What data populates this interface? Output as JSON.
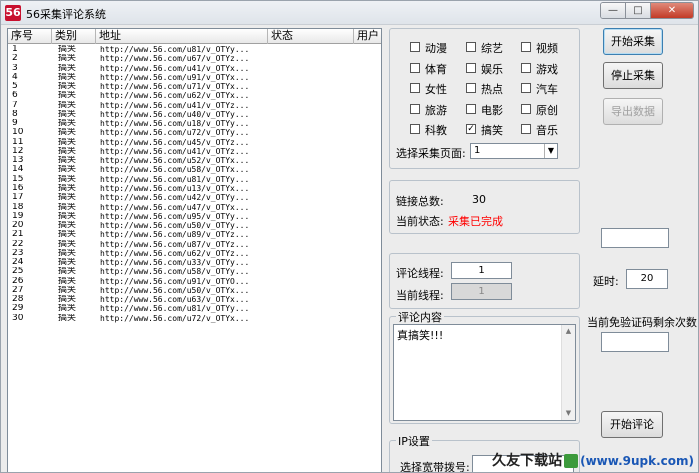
{
  "window": {
    "title": "56采集评论系统",
    "controls": {
      "minimize": "—",
      "maximize": "□",
      "close": "✕"
    }
  },
  "list": {
    "columns": [
      "序号",
      "类别",
      "地址",
      "状态",
      "用户"
    ],
    "rows": [
      {
        "num": "1",
        "cat": "搞笑",
        "url": "http://www.56.com/u81/v_OTYy..."
      },
      {
        "num": "2",
        "cat": "搞笑",
        "url": "http://www.56.com/u67/v_OTYz..."
      },
      {
        "num": "3",
        "cat": "搞笑",
        "url": "http://www.56.com/u41/v_OTYx..."
      },
      {
        "num": "4",
        "cat": "搞笑",
        "url": "http://www.56.com/u91/v_OTYx..."
      },
      {
        "num": "5",
        "cat": "搞笑",
        "url": "http://www.56.com/u71/v_OTYx..."
      },
      {
        "num": "6",
        "cat": "搞笑",
        "url": "http://www.56.com/u62/v_OTYx..."
      },
      {
        "num": "7",
        "cat": "搞笑",
        "url": "http://www.56.com/u41/v_OTYz..."
      },
      {
        "num": "8",
        "cat": "搞笑",
        "url": "http://www.56.com/u40/v_OTYy..."
      },
      {
        "num": "9",
        "cat": "搞笑",
        "url": "http://www.56.com/u18/v_OTYy..."
      },
      {
        "num": "10",
        "cat": "搞笑",
        "url": "http://www.56.com/u72/v_OTYy..."
      },
      {
        "num": "11",
        "cat": "搞笑",
        "url": "http://www.56.com/u45/v_OTYz..."
      },
      {
        "num": "12",
        "cat": "搞笑",
        "url": "http://www.56.com/u41/v_OTYz..."
      },
      {
        "num": "13",
        "cat": "搞笑",
        "url": "http://www.56.com/u52/v_OTYx..."
      },
      {
        "num": "14",
        "cat": "搞笑",
        "url": "http://www.56.com/u58/v_OTYx..."
      },
      {
        "num": "15",
        "cat": "搞笑",
        "url": "http://www.56.com/u81/v_OTYy..."
      },
      {
        "num": "16",
        "cat": "搞笑",
        "url": "http://www.56.com/u13/v_OTYx..."
      },
      {
        "num": "17",
        "cat": "搞笑",
        "url": "http://www.56.com/u42/v_OTYy..."
      },
      {
        "num": "18",
        "cat": "搞笑",
        "url": "http://www.56.com/u47/v_OTYx..."
      },
      {
        "num": "19",
        "cat": "搞笑",
        "url": "http://www.56.com/u95/v_OTYy..."
      },
      {
        "num": "20",
        "cat": "搞笑",
        "url": "http://www.56.com/u50/v_OTYy..."
      },
      {
        "num": "21",
        "cat": "搞笑",
        "url": "http://www.56.com/u89/v_OTYz..."
      },
      {
        "num": "22",
        "cat": "搞笑",
        "url": "http://www.56.com/u87/v_OTYz..."
      },
      {
        "num": "23",
        "cat": "搞笑",
        "url": "http://www.56.com/u62/v_OTYz..."
      },
      {
        "num": "24",
        "cat": "搞笑",
        "url": "http://www.56.com/u33/v_OTYy..."
      },
      {
        "num": "25",
        "cat": "搞笑",
        "url": "http://www.56.com/u58/v_OTYy..."
      },
      {
        "num": "26",
        "cat": "搞笑",
        "url": "http://www.56.com/u91/v_OTYO..."
      },
      {
        "num": "27",
        "cat": "搞笑",
        "url": "http://www.56.com/u50/v_OTYx..."
      },
      {
        "num": "28",
        "cat": "搞笑",
        "url": "http://www.56.com/u63/v_OTYx..."
      },
      {
        "num": "29",
        "cat": "搞笑",
        "url": "http://www.56.com/u81/v_OTYy..."
      },
      {
        "num": "30",
        "cat": "搞笑",
        "url": "http://www.56.com/u72/v_OTYx..."
      }
    ]
  },
  "categories": {
    "items": [
      {
        "label": "动漫",
        "checked": false
      },
      {
        "label": "综艺",
        "checked": false
      },
      {
        "label": "视频",
        "checked": false
      },
      {
        "label": "体育",
        "checked": false
      },
      {
        "label": "娱乐",
        "checked": false
      },
      {
        "label": "游戏",
        "checked": false
      },
      {
        "label": "女性",
        "checked": false
      },
      {
        "label": "热点",
        "checked": false
      },
      {
        "label": "汽车",
        "checked": false
      },
      {
        "label": "旅游",
        "checked": false
      },
      {
        "label": "电影",
        "checked": false
      },
      {
        "label": "原创",
        "checked": false
      },
      {
        "label": "科教",
        "checked": false
      },
      {
        "label": "搞笑",
        "checked": true
      },
      {
        "label": "音乐",
        "checked": false
      }
    ],
    "page_label": "选择采集页面:",
    "page_value": "1"
  },
  "status": {
    "total_label": "链接总数:",
    "total_value": "30",
    "state_label": "当前状态:",
    "state_value": "采集已完成",
    "state_color": "#ff0000"
  },
  "threads": {
    "comment_threads_label": "评论线程:",
    "comment_threads_value": "1",
    "current_threads_label": "当前线程:",
    "current_threads_value": "1"
  },
  "comment": {
    "title": "评论内容",
    "text": "真搞笑!!!"
  },
  "ip": {
    "title": "IP设置",
    "dial_label": "选择宽带拨号:"
  },
  "buttons": {
    "start_collect": "开始采集",
    "stop_collect": "停止采集",
    "export": "导出数据",
    "start_comment": "开始评论"
  },
  "right_panel": {
    "delay_label": "延时:",
    "delay_value": "20",
    "captcha_label": "当前免验证码剩余次数"
  },
  "watermark": {
    "text": "久友下载站",
    "site": "(www.9upk.com)"
  }
}
